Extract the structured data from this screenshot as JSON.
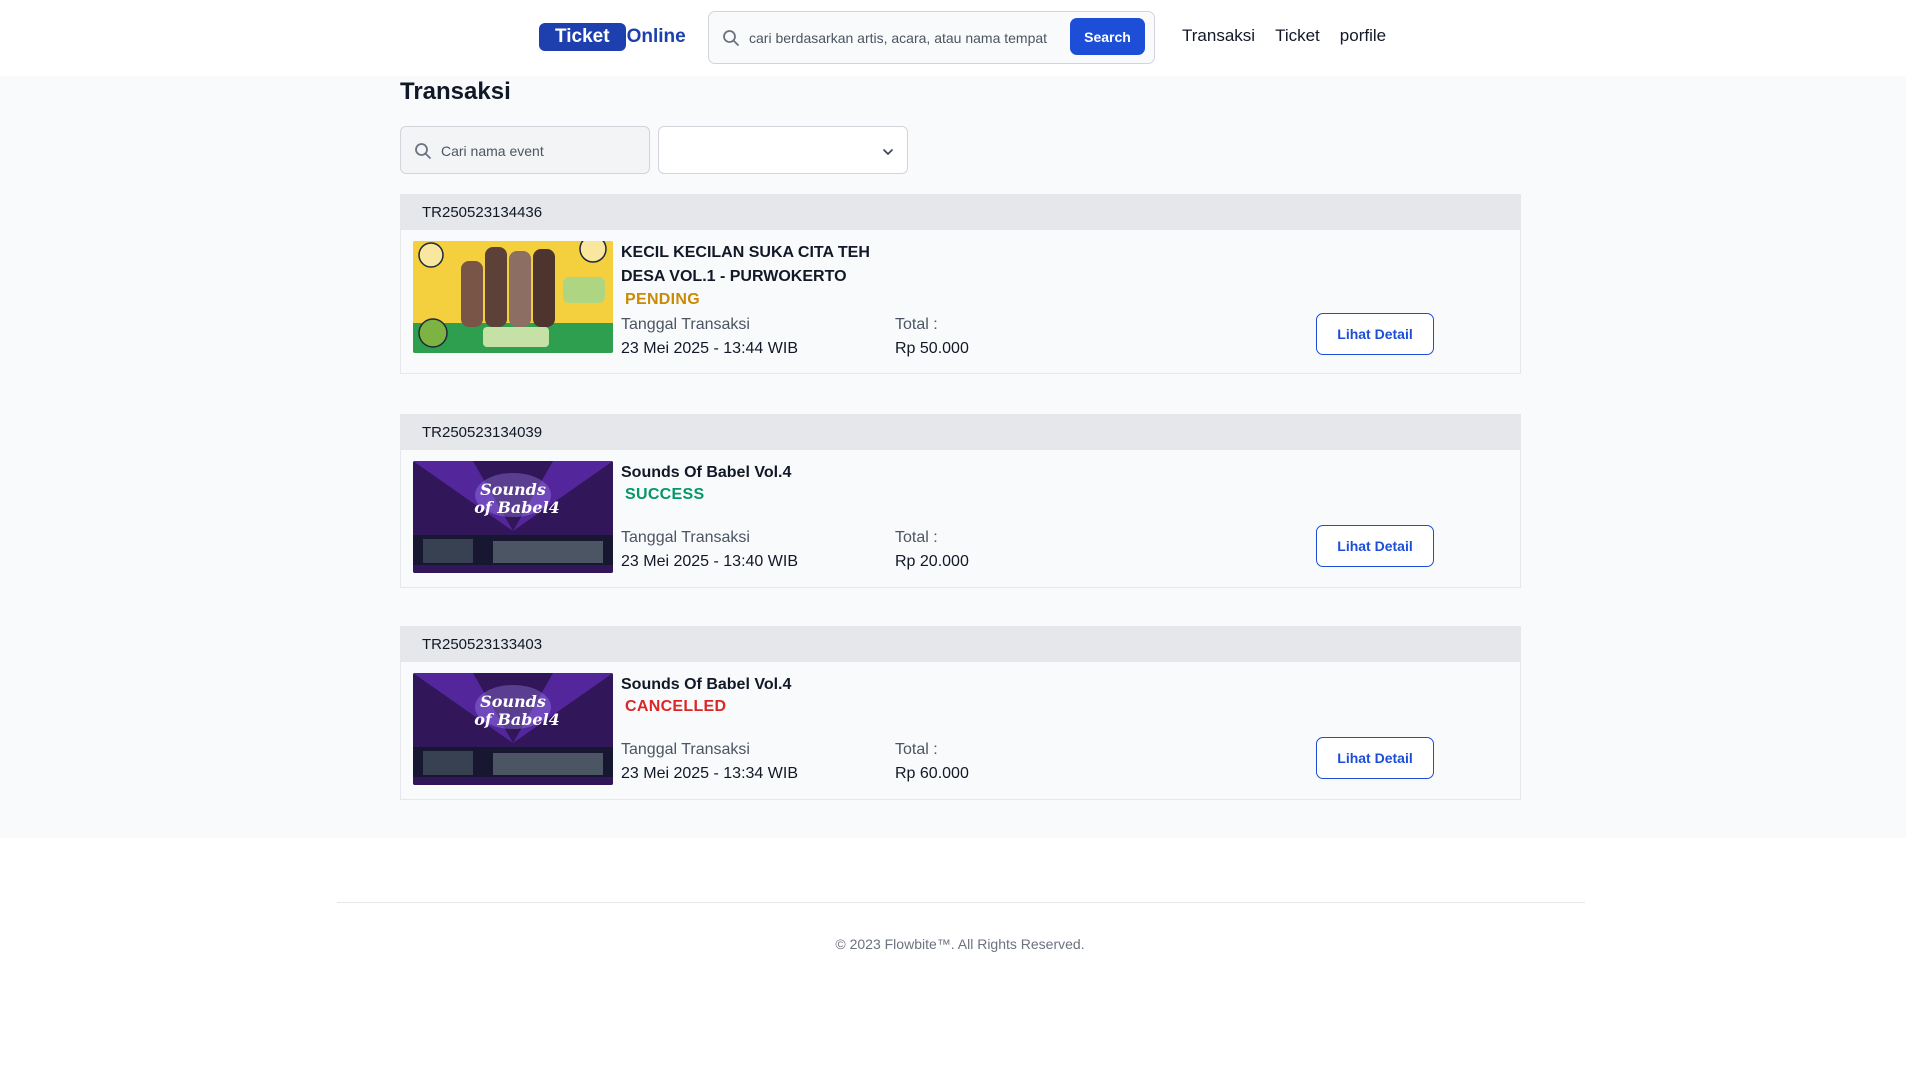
{
  "header": {
    "logo_part1": "Ticket",
    "logo_part2": "Online",
    "search_placeholder": "cari berdasarkan artis, acara, atau nama tempat",
    "search_button": "Search",
    "nav": [
      "Transaksi",
      "Ticket",
      "porfile"
    ]
  },
  "main": {
    "title": "Transaksi",
    "filter_placeholder": "Cari nama event",
    "select_value": ""
  },
  "transactions": [
    {
      "id": "TR250523134436",
      "event": "KECIL KECILAN SUKA CITA TEH DESA VOL.1 - PURWOKERTO",
      "status": "PENDING",
      "status_color": "#ca8a04",
      "date_label": "Tanggal Transaksi",
      "date": "23 Mei 2025 - 13:44 WIB",
      "total_label": "Total :",
      "total": "Rp 50.000",
      "button": "Lihat Detail"
    },
    {
      "id": "TR250523134039",
      "event": "Sounds Of Babel Vol.4",
      "status": "SUCCESS",
      "status_color": "#059669",
      "date_label": "Tanggal Transaksi",
      "date": "23 Mei 2025 - 13:40 WIB",
      "total_label": "Total :",
      "total": "Rp 20.000",
      "button": "Lihat Detail"
    },
    {
      "id": "TR250523133403",
      "event": "Sounds Of Babel Vol.4",
      "status": "CANCELLED",
      "status_color": "#dc2626",
      "date_label": "Tanggal Transaksi",
      "date": "23 Mei 2025 - 13:34 WIB",
      "total_label": "Total :",
      "total": "Rp 60.000",
      "button": "Lihat Detail"
    }
  ],
  "footer": {
    "copyright": "© 2023 Flowbite™. All Rights Reserved."
  }
}
